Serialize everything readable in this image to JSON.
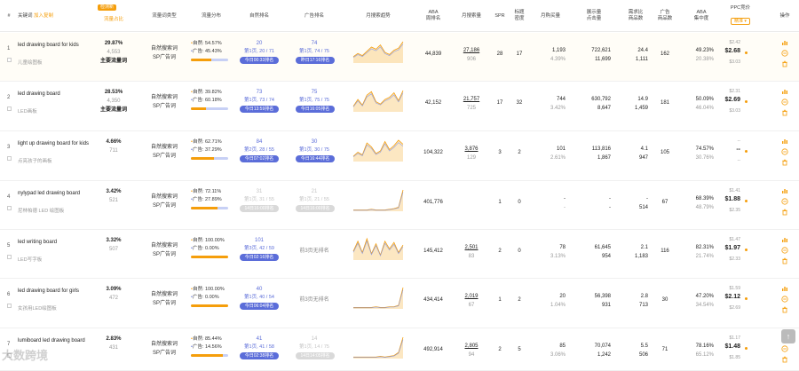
{
  "header": {
    "idx": "#",
    "keyword": "关键词",
    "sort_link": "加入复制",
    "hot_badge": "检测新",
    "traffic_share": "流量占比",
    "kw_type": "流量词类型",
    "traffic_dist": "流量分布",
    "organic_rank": "自然排名",
    "ad_rank": "广告排名",
    "monthly_trend": "月搜索趋势",
    "aba": "ABA\n周排名",
    "monthly_search": "月搜索量",
    "spr": "SPR",
    "title_density": "标题\n密度",
    "monthly_buy": "月购买量",
    "impressions": "展示量\n点击量",
    "click_ratio": "需求比\n商品数",
    "ad_products": "广告\n商品数",
    "aba_conc": "ABA\n集中度",
    "ppc": "PPC竞价",
    "ppc_btn": "精准 ▾",
    "action": "操作"
  },
  "rows": [
    {
      "idx": "1",
      "keyword": "led drawing board for kids",
      "keyword_cn": "儿童绘图板",
      "share": "29.87%",
      "share_vol": "4,553",
      "share_tag": "主要流量词",
      "types": [
        "自然搜索词",
        "SP广告词"
      ],
      "organic_pct": "54.57%",
      "ad_pct": "45.43%",
      "organic_frac": 0.5457,
      "org_rank": "20",
      "org_page": "第1页, 20 / 71",
      "org_time": "今日00:33排名",
      "ad_rank": "74",
      "ad_page": "第1页, 74 / 75",
      "ad_time": "昨日17:16排名",
      "aba": "44,839",
      "msearch": "27,186",
      "msearch2": "906",
      "spr": "28",
      "title": "17",
      "buy": "1,193",
      "buy_rate": "4.39%",
      "imp": "722,621",
      "clicks": "11,699",
      "ratio": "24.4",
      "ratio2": "1,111",
      "adprod": "162",
      "conc": "49.23%",
      "conc2": "20.38%",
      "ppc_lo": "$2.42",
      "ppc_mid": "$2.68",
      "ppc_hi": "$3.03",
      "trend": [
        12,
        18,
        14,
        22,
        30,
        26,
        34,
        20,
        16,
        24,
        28,
        40
      ]
    },
    {
      "idx": "2",
      "keyword": "led drawing board",
      "keyword_cn": "LED画板",
      "share": "28.53%",
      "share_vol": "4,350",
      "share_tag": "主要流量词",
      "types": [
        "自然搜索词",
        "SP广告词"
      ],
      "organic_pct": "39.82%",
      "ad_pct": "60.18%",
      "organic_frac": 0.3982,
      "org_rank": "73",
      "org_page": "第1页, 73 / 74",
      "org_time": "今日13:59排名",
      "ad_rank": "75",
      "ad_page": "第1页, 75 / 75",
      "ad_time": "今日16:05排名",
      "aba": "42,152",
      "msearch": "21,757",
      "msearch2": "725",
      "spr": "17",
      "title": "32",
      "buy": "744",
      "buy_rate": "3.42%",
      "imp": "630,792",
      "clicks": "8,647",
      "ratio": "14.9",
      "ratio2": "1,459",
      "adprod": "181",
      "conc": "50.09%",
      "conc2": "46.04%",
      "ppc_lo": "$2.31",
      "ppc_mid": "$2.69",
      "ppc_hi": "$3.03",
      "trend": [
        10,
        22,
        12,
        30,
        36,
        18,
        14,
        22,
        26,
        34,
        20,
        38
      ]
    },
    {
      "idx": "3",
      "keyword": "light up drawing board for kids",
      "keyword_cn": "点亮孩子的画板",
      "share": "4.66%",
      "share_vol": "711",
      "share_tag": "",
      "types": [
        "自然搜索词",
        "SP广告词"
      ],
      "organic_pct": "62.71%",
      "ad_pct": "37.29%",
      "organic_frac": 0.6271,
      "org_rank": "84",
      "org_page": "第2页, 28 / 55",
      "org_time": "今日07:02排名",
      "ad_rank": "30",
      "ad_page": "第1页, 30 / 75",
      "ad_time": "今日16:44排名",
      "aba": "104,322",
      "msearch": "3,876",
      "msearch2": "129",
      "spr": "3",
      "title": "2",
      "buy": "101",
      "buy_rate": "2.61%",
      "imp": "113,816",
      "clicks": "1,867",
      "ratio": "4.1",
      "ratio2": "947",
      "adprod": "105",
      "conc": "74.57%",
      "conc2": "30.76%",
      "ppc_lo": "--",
      "ppc_mid": "--",
      "ppc_hi": "--",
      "trend": [
        8,
        14,
        10,
        28,
        22,
        12,
        16,
        30,
        18,
        24,
        32,
        26
      ]
    },
    {
      "idx": "4",
      "keyword": "nylypad led drawing board",
      "keyword_cn": "尼林帕德 LED 绘图板",
      "share": "3.42%",
      "share_vol": "521",
      "share_tag": "",
      "types": [
        "自然搜索词",
        "SP广告词"
      ],
      "organic_pct": "72.11%",
      "ad_pct": "27.89%",
      "organic_frac": 0.7211,
      "org_rank": "31",
      "org_page": "第1页, 31 / 55",
      "org_time": "14日16:00排名",
      "ad_rank": "21",
      "ad_page": "第1页, 21 / 55",
      "ad_time": "14日16:00排名",
      "aba": "401,776",
      "msearch": "",
      "msearch2": "",
      "spr": "1",
      "title": "0",
      "buy": "-",
      "buy_rate": "-",
      "imp": "-",
      "clicks": "-",
      "ratio": "-",
      "ratio2": "514",
      "adprod": "67",
      "conc": "68.39%",
      "conc2": "48.79%",
      "ppc_lo": "$1.41",
      "ppc_mid": "$1.88",
      "ppc_hi": "$2.35",
      "trend": [
        2,
        2,
        2,
        2,
        3,
        2,
        2,
        2,
        3,
        4,
        6,
        32
      ]
    },
    {
      "idx": "5",
      "keyword": "led writing board",
      "keyword_cn": "LED写字板",
      "share": "3.32%",
      "share_vol": "507",
      "share_tag": "",
      "types": [
        "自然搜索词",
        "SP广告词"
      ],
      "organic_pct": "100.00%",
      "ad_pct": "0.00%",
      "organic_frac": 1.0,
      "org_rank": "101",
      "org_page": "第3页, 42 / 59",
      "org_time": "今日02:16排名",
      "ad_rank": "前3页无排名",
      "ad_page": "",
      "ad_time": "",
      "aba": "145,412",
      "msearch": "2,501",
      "msearch2": "83",
      "spr": "2",
      "title": "0",
      "buy": "78",
      "buy_rate": "3.13%",
      "imp": "61,645",
      "clicks": "954",
      "ratio": "2.1",
      "ratio2": "1,183",
      "adprod": "116",
      "conc": "82.31%",
      "conc2": "21.74%",
      "ppc_lo": "$1.47",
      "ppc_mid": "$1.97",
      "ppc_hi": "$2.33",
      "trend": [
        14,
        30,
        12,
        34,
        10,
        26,
        8,
        30,
        18,
        28,
        12,
        24
      ]
    },
    {
      "idx": "6",
      "keyword": "led drawing board for girls",
      "keyword_cn": "女孩用LED绘图板",
      "share": "3.09%",
      "share_vol": "472",
      "share_tag": "",
      "types": [
        "自然搜索词",
        "SP广告词"
      ],
      "organic_pct": "100.00%",
      "ad_pct": "0.00%",
      "organic_frac": 1.0,
      "org_rank": "40",
      "org_page": "第1页, 40 / 54",
      "org_time": "今日06:04排名",
      "ad_rank": "前3页无排名",
      "ad_page": "",
      "ad_time": "",
      "aba": "434,414",
      "msearch": "2,019",
      "msearch2": "67",
      "spr": "1",
      "title": "2",
      "buy": "20",
      "buy_rate": "1.04%",
      "imp": "56,398",
      "clicks": "931",
      "ratio": "2.8",
      "ratio2": "713",
      "adprod": "30",
      "conc": "47.20%",
      "conc2": "34.54%",
      "ppc_lo": "$1.59",
      "ppc_mid": "$2.12",
      "ppc_hi": "$2.69",
      "trend": [
        2,
        2,
        2,
        2,
        2,
        3,
        2,
        2,
        3,
        3,
        5,
        30
      ]
    },
    {
      "idx": "7",
      "keyword": "lumiboard led drawing board",
      "keyword_cn": "",
      "share": "2.83%",
      "share_vol": "431",
      "share_tag": "",
      "types": [
        "自然搜索词",
        "SP广告词"
      ],
      "organic_pct": "85.44%",
      "ad_pct": "14.56%",
      "organic_frac": 0.8544,
      "org_rank": "41",
      "org_page": "第1页, 41 / 58",
      "org_time": "今日02:38排名",
      "ad_rank": "14",
      "ad_page": "第1页, 14 / 75",
      "ad_time": "14日14:05排名",
      "aba": "492,914",
      "msearch": "2,805",
      "msearch2": "94",
      "spr": "2",
      "title": "5",
      "buy": "85",
      "buy_rate": "3.06%",
      "imp": "70,074",
      "clicks": "1,242",
      "ratio": "5.5",
      "ratio2": "506",
      "adprod": "71",
      "conc": "78.16%",
      "conc2": "65.12%",
      "ppc_lo": "$1.17",
      "ppc_mid": "$1.48",
      "ppc_hi": "$1.85",
      "trend": [
        2,
        2,
        2,
        2,
        2,
        2,
        3,
        2,
        3,
        4,
        8,
        28
      ]
    }
  ],
  "watermark": "大数跨境",
  "colors": {
    "accent": "#f59e0b",
    "blue": "#5b6dd9",
    "light_blue": "#c7d0f5"
  }
}
